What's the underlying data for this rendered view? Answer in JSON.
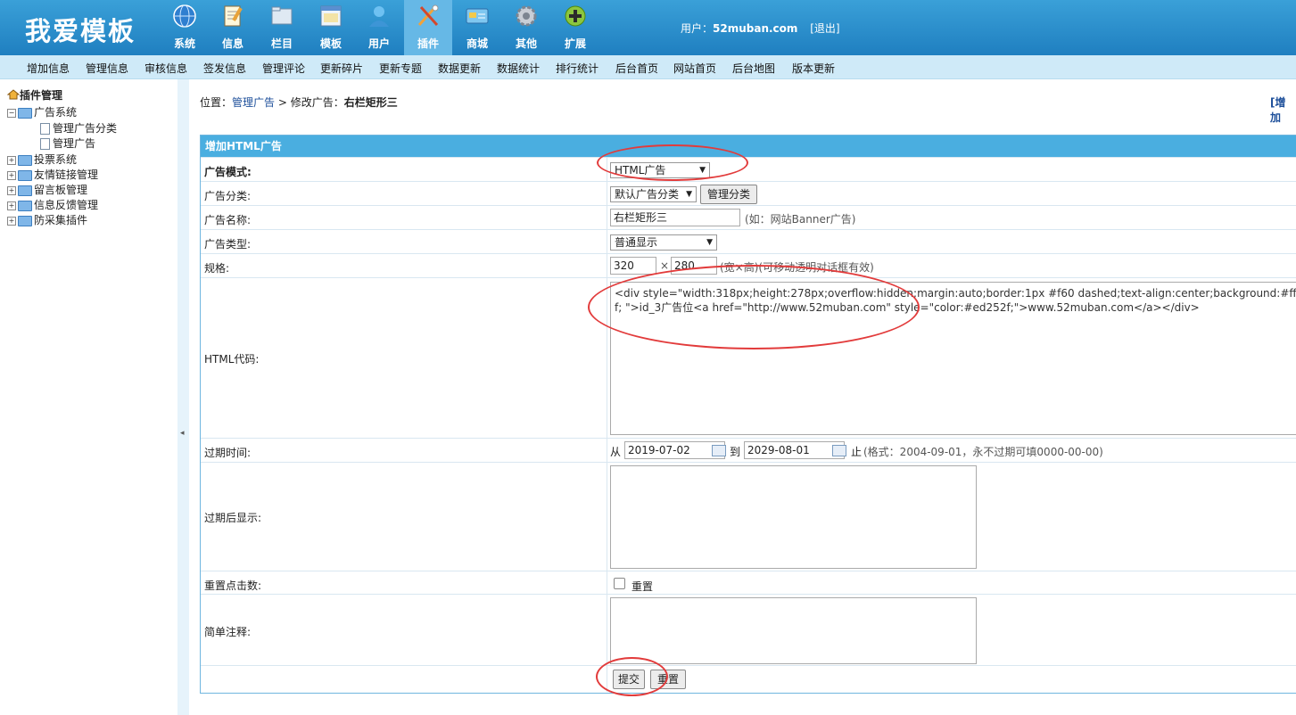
{
  "header": {
    "logo": "我爱模板",
    "nav": [
      {
        "label": "系统",
        "icon": "globe-icon"
      },
      {
        "label": "信息",
        "icon": "notepad-icon"
      },
      {
        "label": "栏目",
        "icon": "folder-icon"
      },
      {
        "label": "模板",
        "icon": "window-icon"
      },
      {
        "label": "用户",
        "icon": "user-icon"
      },
      {
        "label": "插件",
        "icon": "tools-icon"
      },
      {
        "label": "商城",
        "icon": "card-icon"
      },
      {
        "label": "其他",
        "icon": "gear-icon"
      },
      {
        "label": "扩展",
        "icon": "plus-icon"
      }
    ],
    "user_prefix": "用户：",
    "username": "52muban.com",
    "logout": "[退出]"
  },
  "menubar": [
    "增加信息",
    "管理信息",
    "审核信息",
    "签发信息",
    "管理评论",
    "更新碎片",
    "更新专题",
    "数据更新",
    "数据统计",
    "排行统计",
    "后台首页",
    "网站首页",
    "后台地图",
    "版本更新"
  ],
  "sidebar": {
    "root": "插件管理",
    "items": [
      {
        "label": "广告系统",
        "expanded": true
      },
      {
        "label": "管理广告分类"
      },
      {
        "label": "管理广告"
      },
      {
        "label": "投票系统"
      },
      {
        "label": "友情链接管理"
      },
      {
        "label": "留言板管理"
      },
      {
        "label": "信息反馈管理"
      },
      {
        "label": "防采集插件"
      }
    ],
    "collapse_arrow": "◂"
  },
  "breadcrumb": {
    "prefix": "位置：",
    "link": "管理广告",
    "sep": " > 修改广告：",
    "current": "右栏矩形三"
  },
  "add_link": "[增加",
  "form": {
    "title": "增加HTML广告",
    "labels": {
      "mode": "广告模式:",
      "category": "广告分类:",
      "name": "广告名称:",
      "type": "广告类型:",
      "size": "规格:",
      "html": "HTML代码:",
      "expire": "过期时间:",
      "after_expire": "过期后显示:",
      "reset_clicks": "重置点击数:",
      "note": "简单注释:"
    },
    "mode_value": "HTML广告",
    "category_value": "默认广告分类",
    "manage_category_button": "管理分类",
    "name_value": "右栏矩形三",
    "name_hint": "(如：网站Banner广告)",
    "type_value": "普通显示",
    "width": "320",
    "times": "×",
    "height": "280",
    "size_hint": "(宽×高)(可移动透明对话框有效)",
    "html_code": "<div style=\"width:318px;height:278px;overflow:hidden;margin:auto;border:1px #f60 dashed;text-align:center;background:#fff; \">id_3广告位<a href=\"http://www.52muban.com\" style=\"color:#ed252f;\">www.52muban.com</a></div>",
    "from": "从",
    "start_date": "2019-07-02",
    "to": "到",
    "end_date": "2029-08-01",
    "stop": "止",
    "expire_hint": "(格式：2004-09-01，永不过期可填0000-00-00)",
    "reset_label": "重置",
    "submit": "提交",
    "reset": "重置"
  }
}
